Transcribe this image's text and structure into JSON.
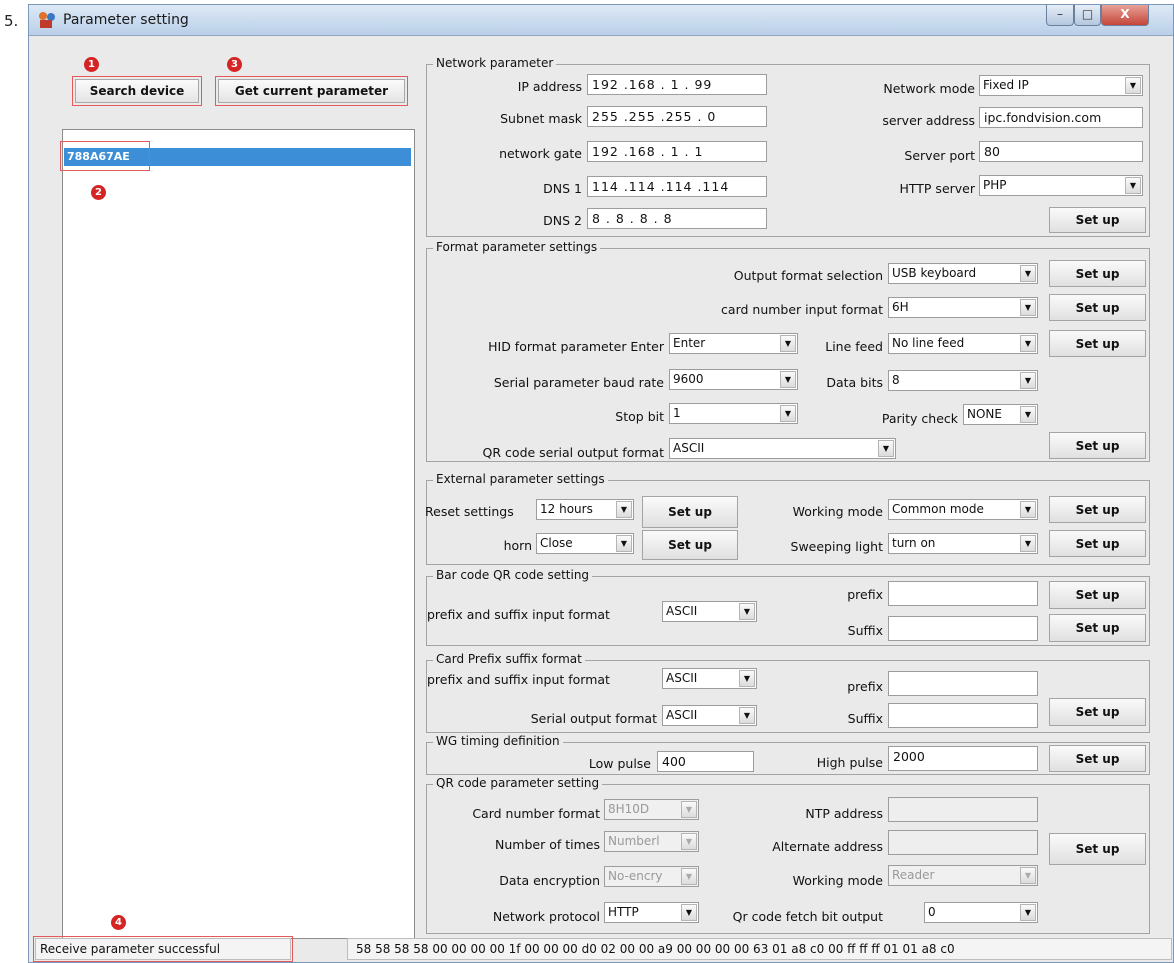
{
  "list_number": "5.",
  "window": {
    "title": "Parameter setting",
    "close_glyph": "X"
  },
  "left": {
    "search_device": "Search device",
    "get_current_parameter": "Get current parameter",
    "device_list": [
      "788A67AE"
    ],
    "status": "Receive parameter successful"
  },
  "badges": [
    "1",
    "2",
    "3",
    "4"
  ],
  "network": {
    "title": "Network parameter",
    "ip_label": "IP address",
    "ip_value": "192 .168 . 1 . 99",
    "mask_label": "Subnet mask",
    "mask_value": "255 .255 .255 . 0",
    "gate_label": "network gate",
    "gate_value": "192 .168 . 1 . 1",
    "dns1_label": "DNS 1",
    "dns1_value": "114 .114 .114 .114",
    "dns2_label": "DNS 2",
    "dns2_value": "8 . 8 . 8 . 8",
    "mode_label": "Network mode",
    "mode_value": "Fixed IP",
    "server_label": "server address",
    "server_value": "ipc.fondvision.com",
    "port_label": "Server port",
    "port_value": "80",
    "http_label": "HTTP server",
    "http_value": "PHP",
    "setup": "Set up"
  },
  "format": {
    "title": "Format parameter settings",
    "output_label": "Output format selection",
    "output_value": "USB keyboard",
    "card_label": "card number input format",
    "card_value": "6H",
    "hid_label": "HID format parameter  Enter",
    "hid_value": "Enter",
    "linefeed_label": "Line feed",
    "linefeed_value": "No line feed",
    "baud_label": "Serial parameter baud rate",
    "baud_value": "9600",
    "databits_label": "Data bits",
    "databits_value": "8",
    "stopbit_label": "Stop bit",
    "stopbit_value": "1",
    "parity_label": "Parity check",
    "parity_value": "NONE",
    "qr_label": "QR code serial output format",
    "qr_value": "ASCII",
    "setup": "Set up"
  },
  "external": {
    "title": "External parameter settings",
    "reset_label": "Reset settings",
    "reset_value": "12 hours",
    "horn_label": "horn",
    "horn_value": "Close",
    "working_label": "Working mode",
    "working_value": "Common mode",
    "sweep_label": "Sweeping light",
    "sweep_value": "turn on",
    "setup": "Set up"
  },
  "barcode": {
    "title": "Bar code QR code setting",
    "psinput_label": "prefix and suffix input format",
    "psinput_value": "ASCII",
    "prefix_label": "prefix",
    "suffix_label": "Suffix",
    "setup": "Set up"
  },
  "card_prefix": {
    "title": "Card Prefix suffix format",
    "psinput_label": "prefix and suffix input format",
    "psinput_value": "ASCII",
    "serial_label": "Serial output format",
    "serial_value": "ASCII",
    "prefix_label": "prefix",
    "suffix_label": "Suffix",
    "setup": "Set up"
  },
  "wg": {
    "title": "WG timing definition",
    "low_label": "Low pulse",
    "low_value": "400",
    "high_label": "High pulse",
    "high_value": "2000",
    "setup": "Set up"
  },
  "qr_param": {
    "title": "QR code parameter setting",
    "cardnum_label": "Card number format",
    "cardnum_value": "8H10D",
    "times_label": "Number of times",
    "times_value": "Numberl",
    "encrypt_label": "Data encryption",
    "encrypt_value": "No-encry",
    "protocol_label": "Network protocol",
    "protocol_value": "HTTP",
    "ntp_label": "NTP address",
    "alt_label": "Alternate address",
    "working_label": "Working mode",
    "working_value": "Reader",
    "fetch_label": "Qr code fetch bit output",
    "fetch_value": "0",
    "setup": "Set up"
  },
  "hex_status": "58 58 58 58 00 00 00 00 1f 00 00 00 d0 02 00 00 a9 00 00 00 00 63 01 a8 c0 00 ff ff ff 01 01 a8 c0"
}
